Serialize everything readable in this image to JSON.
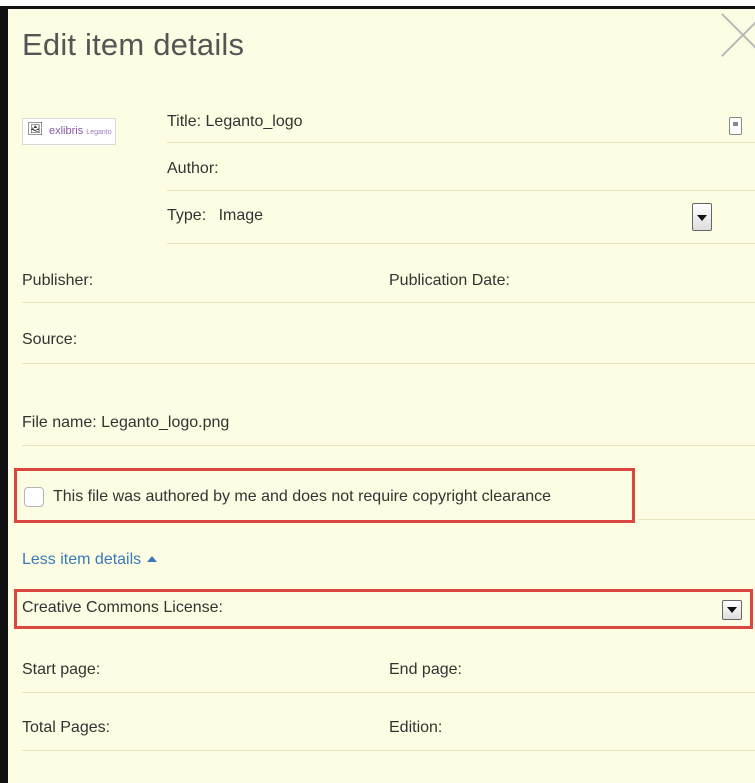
{
  "dialog": {
    "title": "Edit item details"
  },
  "item": {
    "logo_text": "exlibris",
    "logo_sub": "Leganto",
    "title_label": "Title:",
    "title_value": "Leganto_logo",
    "author_label": "Author:",
    "type_label": "Type:",
    "type_value": "Image"
  },
  "fields": {
    "publisher_label": "Publisher:",
    "publication_date_label": "Publication Date:",
    "source_label": "Source:",
    "file_name_label": "File name:",
    "file_name_value": "Leganto_logo.png",
    "copyright_checkbox_label": "This file was authored by me and does not require copyright clearance",
    "less_details_link": "Less item details",
    "creative_commons_label": "Creative Commons License:",
    "start_page_label": "Start page:",
    "end_page_label": "End page:",
    "total_pages_label": "Total Pages:",
    "edition_label": "Edition:"
  },
  "colors": {
    "panel_bg": "#fdfde3",
    "highlight_red": "#d9473f",
    "link_blue": "#3a7ab8"
  }
}
